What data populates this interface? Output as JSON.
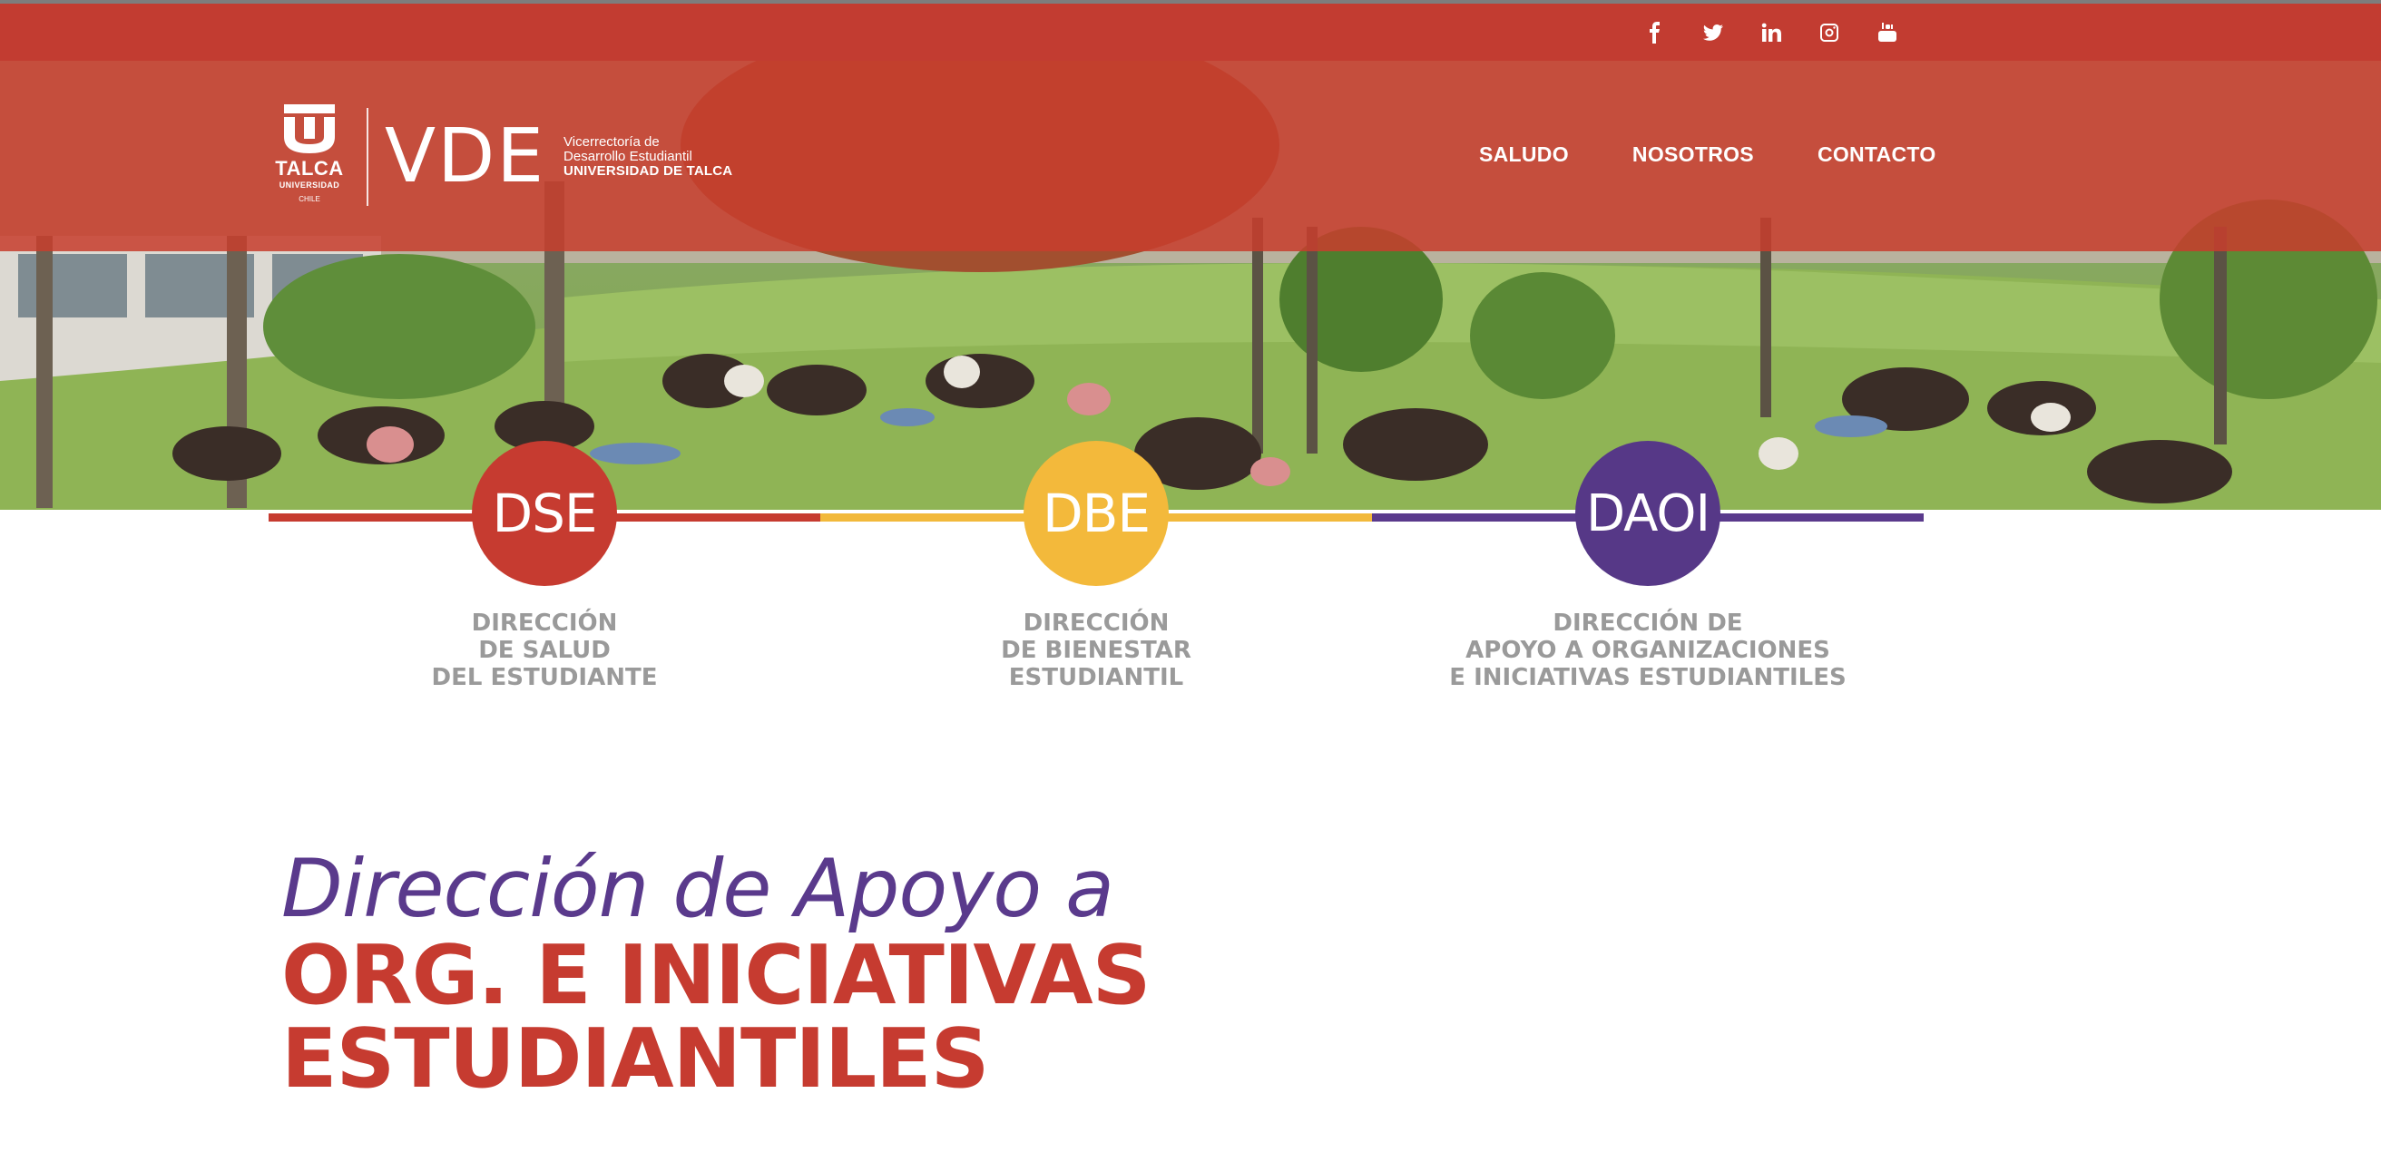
{
  "header": {
    "social": [
      {
        "name": "facebook-icon",
        "glyph": "f"
      },
      {
        "name": "twitter-icon",
        "glyph": "t"
      },
      {
        "name": "linkedin-icon",
        "glyph": "in"
      },
      {
        "name": "instagram-icon",
        "glyph": "ig"
      },
      {
        "name": "youtube-icon",
        "glyph": "You Tube"
      }
    ],
    "logo": {
      "talca_word": "TALCA",
      "talca_sub": "UNIVERSIDAD",
      "talca_country": "CHILE",
      "vde": "VDE",
      "caption": [
        "Vicerrectoría de",
        "Desarrollo Estudiantil",
        "UNIVERSIDAD DE TALCA"
      ]
    },
    "nav": [
      "SALUDO",
      "NOSOTROS",
      "CONTACTO"
    ]
  },
  "directorates": [
    {
      "badge": "DSE",
      "color": "#c63b30",
      "label": [
        "DIRECCIÓN",
        "DE SALUD",
        "DEL ESTUDIANTE"
      ]
    },
    {
      "badge": "DBE",
      "color": "#f3b93b",
      "label": [
        "DIRECCIÓN",
        "DE BIENESTAR",
        "ESTUDIANTIL"
      ]
    },
    {
      "badge": "DAOI",
      "color": "#563887",
      "label": [
        "DIRECCIÓN DE",
        "APOYO A ORGANIZACIONES",
        "E INICIATIVAS ESTUDIANTILES"
      ]
    }
  ],
  "headline": {
    "line1": "Dirección de Apoyo a",
    "line2": "ORG. E INICIATIVAS",
    "line3": "ESTUDIANTILES"
  },
  "colors": {
    "brand_red": "#c63b30",
    "brand_yellow": "#f3b93b",
    "brand_purple": "#563887",
    "label_gray": "#9a9a9a"
  }
}
